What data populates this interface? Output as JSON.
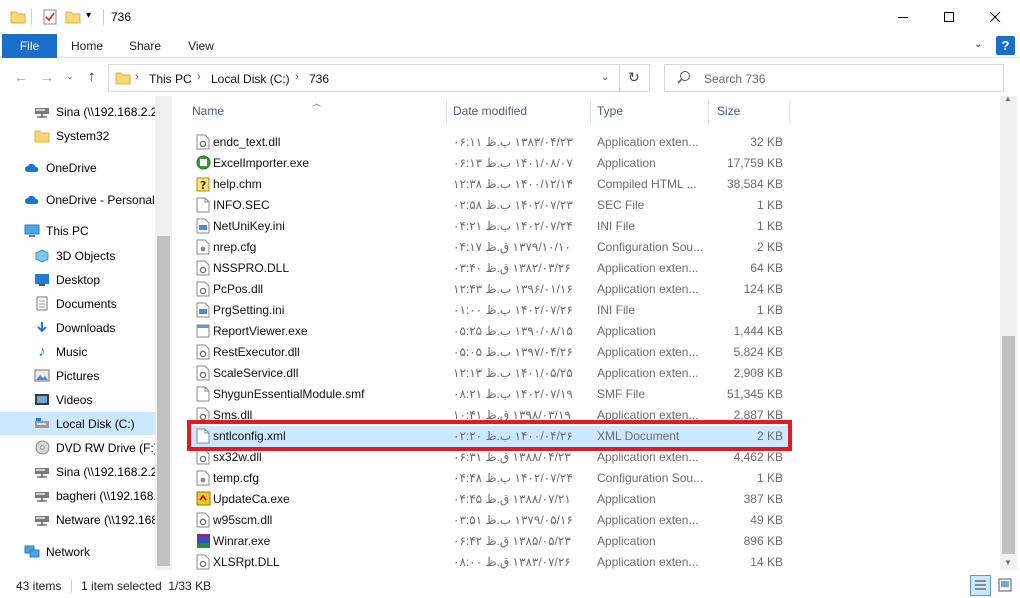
{
  "window": {
    "title": "736",
    "buttons": {
      "minimize": "minimize",
      "maximize": "maximize",
      "close": "close"
    }
  },
  "ribbon": {
    "tabs": [
      "File",
      "Home",
      "Share",
      "View"
    ]
  },
  "address": {
    "crumbs": [
      "This PC",
      "Local Disk (C:)",
      "736"
    ],
    "search_placeholder": "Search 736"
  },
  "nav": {
    "items": [
      {
        "label": "Sina (\\\\192.168.2.2\\",
        "icon": "network-drive-icon"
      },
      {
        "label": "System32",
        "icon": "folder-icon"
      },
      {
        "label": "OneDrive",
        "icon": "cloud-icon"
      },
      {
        "label": "OneDrive - Personal",
        "icon": "cloud-icon"
      },
      {
        "label": "This PC",
        "icon": "computer-icon"
      },
      {
        "label": "3D Objects",
        "icon": "3d-objects-icon"
      },
      {
        "label": "Desktop",
        "icon": "desktop-icon"
      },
      {
        "label": "Documents",
        "icon": "documents-icon"
      },
      {
        "label": "Downloads",
        "icon": "downloads-icon"
      },
      {
        "label": "Music",
        "icon": "music-icon"
      },
      {
        "label": "Pictures",
        "icon": "pictures-icon"
      },
      {
        "label": "Videos",
        "icon": "videos-icon"
      },
      {
        "label": "Local Disk (C:)",
        "icon": "local-disk-icon"
      },
      {
        "label": "DVD RW Drive (F:) S",
        "icon": "dvd-icon"
      },
      {
        "label": "Sina (\\\\192.168.2.2\\",
        "icon": "network-drive-icon"
      },
      {
        "label": "bagheri (\\\\192.168.",
        "icon": "network-drive-icon"
      },
      {
        "label": "Netware (\\\\192.168",
        "icon": "network-drive-icon"
      },
      {
        "label": "Network",
        "icon": "network-icon"
      }
    ]
  },
  "columns": {
    "name": "Name",
    "date": "Date modified",
    "type": "Type",
    "size": "Size"
  },
  "files": [
    {
      "name": "endc_text.dll",
      "date": "۱۳۸۳/۰۴/۲۳ ب.ظ ۰۶:۱۱",
      "type": "Application exten...",
      "size": "32 KB",
      "icon": "dll-icon"
    },
    {
      "name": "ExcelImporter.exe",
      "date": "۱۴۰۱/۰۸/۰۷ ب.ظ ۰۶:۱۳",
      "type": "Application",
      "size": "17,759 KB",
      "icon": "exe-green-icon"
    },
    {
      "name": "help.chm",
      "date": "۱۴۰۰/۱۲/۱۴ ب.ظ ۱۲:۳۸",
      "type": "Compiled HTML ...",
      "size": "38,584 KB",
      "icon": "chm-icon"
    },
    {
      "name": "INFO.SEC",
      "date": "۱۴۰۲/۰۷/۲۳ ب.ظ ۰۲:۵۸",
      "type": "SEC File",
      "size": "1 KB",
      "icon": "file-icon"
    },
    {
      "name": "NetUniKey.ini",
      "date": "۱۴۰۲/۰۷/۲۴ ب.ظ ۰۴:۲۱",
      "type": "INI File",
      "size": "1 KB",
      "icon": "ini-icon"
    },
    {
      "name": "nrep.cfg",
      "date": "۱۳۷۹/۱۰/۱۰ ق.ظ ۰۴:۱۷",
      "type": "Configuration Sou...",
      "size": "2 KB",
      "icon": "cfg-icon"
    },
    {
      "name": "NSSPRO.DLL",
      "date": "۱۳۸۲/۰۳/۲۶ ق.ظ ۰۳:۴۰",
      "type": "Application exten...",
      "size": "64 KB",
      "icon": "dll-icon"
    },
    {
      "name": "PcPos.dll",
      "date": "۱۳۹۶/۰۱/۱۶ ب.ظ ۱۲:۴۳",
      "type": "Application exten...",
      "size": "124 KB",
      "icon": "dll-icon"
    },
    {
      "name": "PrgSetting.ini",
      "date": "۱۴۰۲/۰۷/۲۶ ب.ظ ۰۱:۰۰",
      "type": "INI File",
      "size": "1 KB",
      "icon": "ini-icon"
    },
    {
      "name": "ReportViewer.exe",
      "date": "۱۳۹۰/۰۸/۱۵ ب.ظ ۰۵:۲۵",
      "type": "Application",
      "size": "1,444 KB",
      "icon": "exe-icon"
    },
    {
      "name": "RestExecutor.dll",
      "date": "۱۳۹۷/۰۴/۲۶ ب.ظ ۰۵:۰۵",
      "type": "Application exten...",
      "size": "5,824 KB",
      "icon": "dll-icon"
    },
    {
      "name": "ScaleService.dll",
      "date": "۱۴۰۱/۰۵/۲۵ ب.ظ ۱۲:۱۳",
      "type": "Application exten...",
      "size": "2,908 KB",
      "icon": "dll-icon"
    },
    {
      "name": "ShygunEssentialModule.smf",
      "date": "۱۴۰۲/۰۷/۱۹ ب.ظ ۰۸:۲۱",
      "type": "SMF File",
      "size": "51,345 KB",
      "icon": "file-icon"
    },
    {
      "name": "Sms.dll",
      "date": "۱۳۹۸/۰۳/۱۹ ق.ظ ۱۰:۴۱",
      "type": "Application exten...",
      "size": "2,887 KB",
      "icon": "dll-icon"
    },
    {
      "name": "sntlconfig.xml",
      "date": "۱۴۰۰/۰۴/۲۶ ب.ظ ۰۲:۲۰",
      "type": "XML Document",
      "size": "2 KB",
      "icon": "file-icon",
      "selected": true
    },
    {
      "name": "sx32w.dll",
      "date": "۱۳۸۸/۰۴/۲۳ ق.ظ ۰۶:۳۱",
      "type": "Application exten...",
      "size": "4,462 KB",
      "icon": "dll-icon"
    },
    {
      "name": "temp.cfg",
      "date": "۱۴۰۲/۰۷/۲۴ ب.ظ ۰۴:۴۸",
      "type": "Configuration Sou...",
      "size": "1 KB",
      "icon": "cfg-icon"
    },
    {
      "name": "UpdateCa.exe",
      "date": "۱۳۸۸/۰۷/۲۱ ق.ظ ۰۴:۴۵",
      "type": "Application",
      "size": "387 KB",
      "icon": "update-exe-icon"
    },
    {
      "name": "w95scm.dll",
      "date": "۱۳۷۹/۰۵/۱۶ ب.ظ ۰۳:۵۱",
      "type": "Application exten...",
      "size": "49 KB",
      "icon": "dll-icon"
    },
    {
      "name": "Winrar.exe",
      "date": "۱۳۸۵/۰۵/۲۳ ق.ظ ۰۶:۴۲",
      "type": "Application",
      "size": "896 KB",
      "icon": "winrar-icon"
    },
    {
      "name": "XLSRpt.DLL",
      "date": "۱۳۸۳/۰۷/۲۶ ق.ظ ۰۸:۰۰",
      "type": "Application exten...",
      "size": "14 KB",
      "icon": "dll-icon"
    }
  ],
  "status": {
    "count": "43 items",
    "selection": "1 item selected  1/33 KB"
  },
  "colors": {
    "accent": "#1a6fc9",
    "selection": "#cce8ff",
    "highlight_border": "#e21b23"
  }
}
